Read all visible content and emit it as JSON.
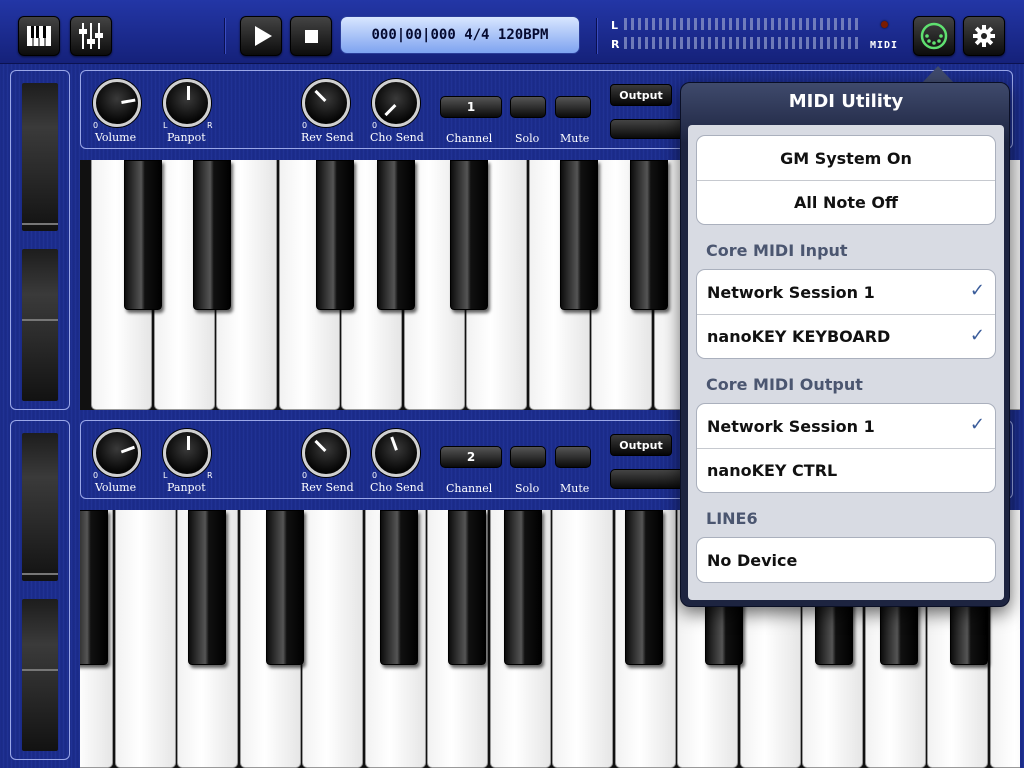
{
  "toolbar": {
    "piano_icon": "piano-keys-icon",
    "mixer_icon": "mixer-sliders-icon",
    "play_icon": "play-icon",
    "stop_icon": "stop-icon",
    "position_display": "000|00|000 4/4 120BPM",
    "meter_left_label": "L",
    "meter_right_label": "R",
    "midi_label": "MIDI",
    "midi_icon": "midi-connector-icon",
    "settings_icon": "gear-icon"
  },
  "parts": [
    {
      "knobs": {
        "volume": "Volume",
        "panpot": "Panpot",
        "rev_send": "Rev Send",
        "cho_send": "Cho Send"
      },
      "channel_label": "Channel",
      "channel_value": "1",
      "solo_label": "Solo",
      "mute_label": "Mute",
      "output_label": "Output"
    },
    {
      "knobs": {
        "volume": "Volume",
        "panpot": "Panpot",
        "rev_send": "Rev Send",
        "cho_send": "Cho Send"
      },
      "channel_label": "Channel",
      "channel_value": "2",
      "solo_label": "Solo",
      "mute_label": "Mute",
      "output_label": "Output"
    }
  ],
  "knob_marks": {
    "zero": "0",
    "left": "L",
    "right": "R"
  },
  "midi_utility": {
    "title": "MIDI Utility",
    "actions": [
      "GM System On",
      "All Note Off"
    ],
    "core_input_header": "Core MIDI Input",
    "core_input": [
      {
        "label": "Network Session 1",
        "checked": true
      },
      {
        "label": "nanoKEY KEYBOARD",
        "checked": true
      }
    ],
    "core_output_header": "Core MIDI Output",
    "core_output": [
      {
        "label": "Network Session 1",
        "checked": true
      },
      {
        "label": "nanoKEY CTRL",
        "checked": false
      }
    ],
    "line6_header": "LINE6",
    "line6": [
      {
        "label": "No Device"
      }
    ],
    "check_mark": "✓"
  },
  "colors": {
    "background": "#1b2b88",
    "accent": "#3a5c9a",
    "lcd": "#a9c2f8"
  }
}
